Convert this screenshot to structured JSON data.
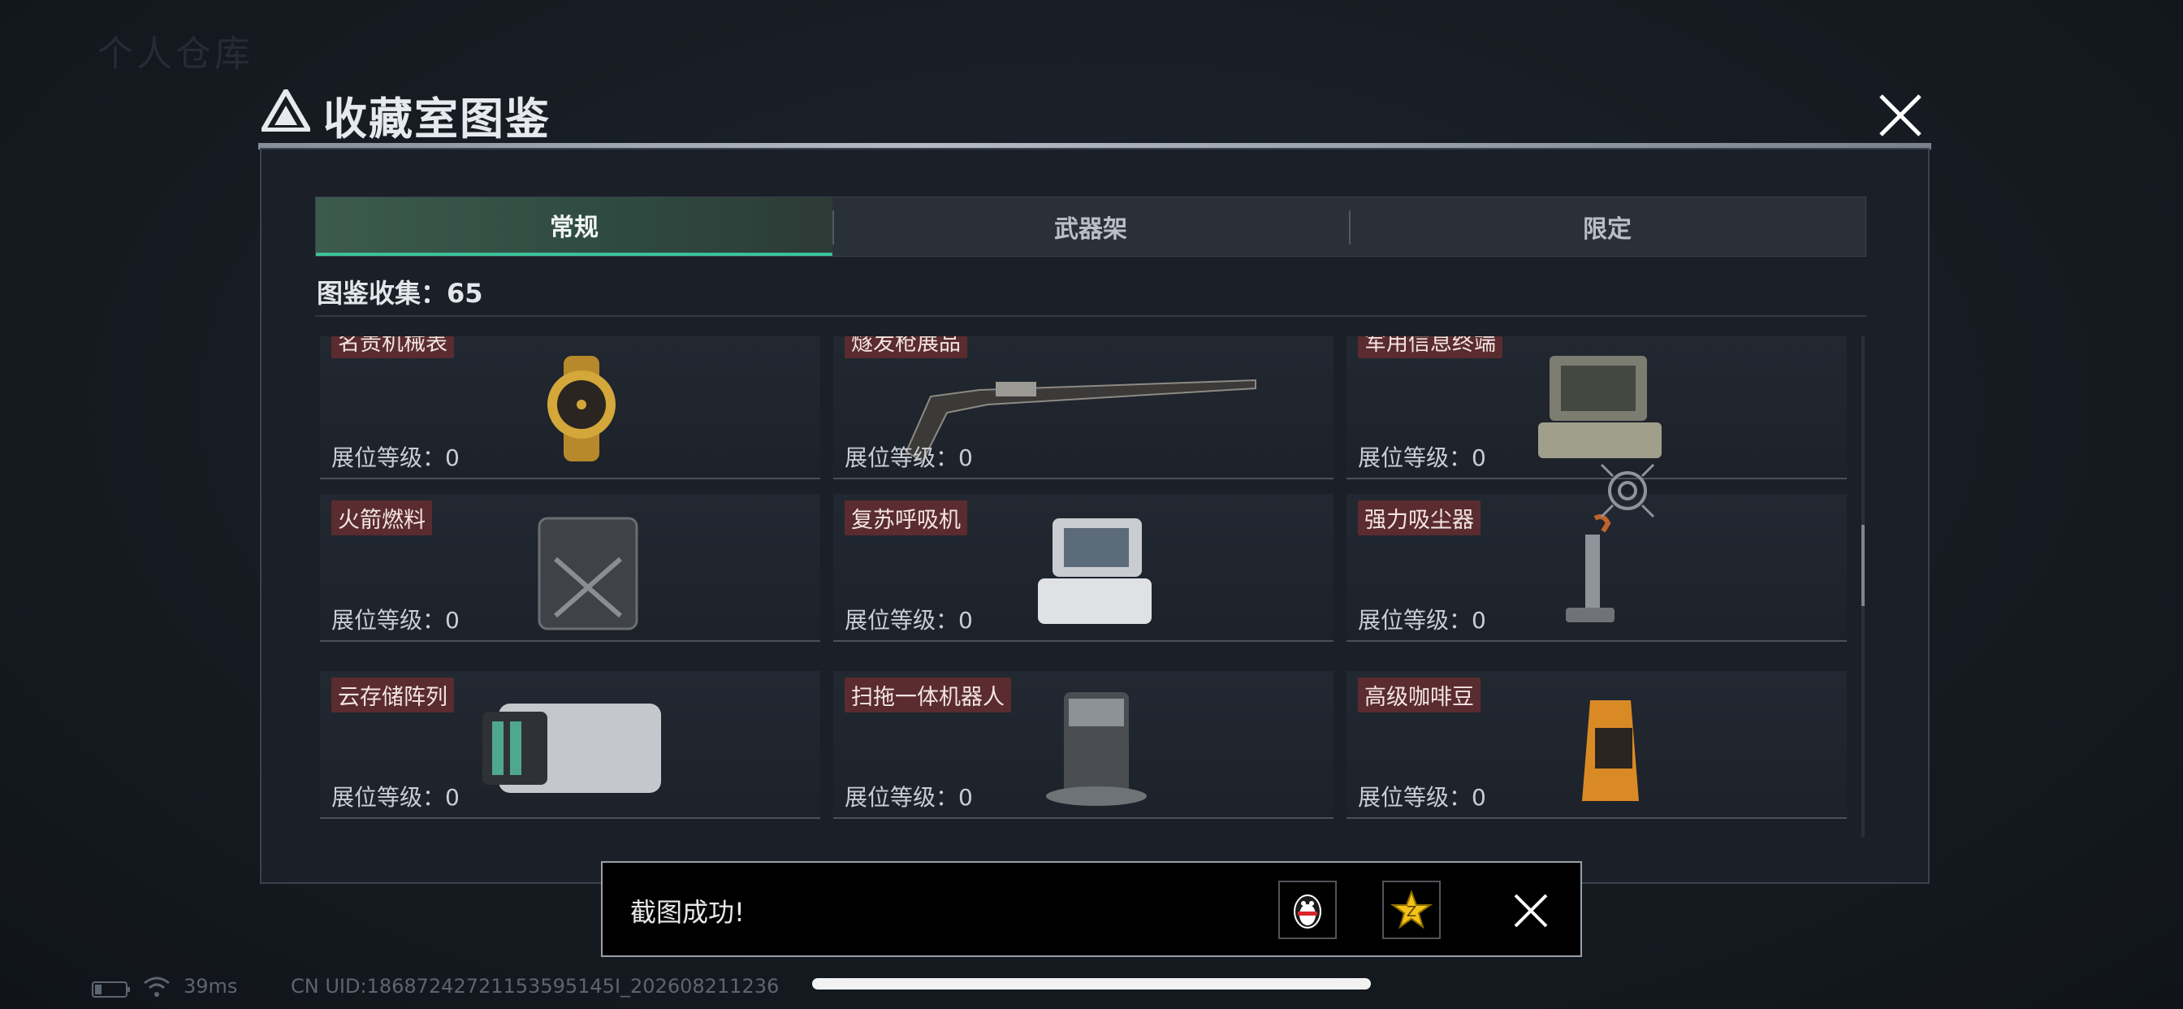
{
  "background": {
    "ghost_title": "个人仓库"
  },
  "modal": {
    "title": "收藏室图鉴",
    "tabs": [
      {
        "label": "常规",
        "active": true
      },
      {
        "label": "武器架",
        "active": false
      },
      {
        "label": "限定",
        "active": false
      }
    ],
    "collection_label": "图鉴收集：65",
    "items": [
      {
        "name": "名贵机械表",
        "level": "展位等级：0",
        "icon": "gold-watch"
      },
      {
        "name": "燧发枪展品",
        "level": "展位等级：0",
        "icon": "flintlock-rifle"
      },
      {
        "name": "军用信息终端",
        "level": "展位等级：0",
        "icon": "rugged-terminal-case"
      },
      {
        "name": "火箭燃料",
        "level": "展位等级：0",
        "icon": "fuel-canister"
      },
      {
        "name": "复苏呼吸机",
        "level": "展位等级：0",
        "icon": "ventilator"
      },
      {
        "name": "强力吸尘器",
        "level": "展位等级：0",
        "icon": "vacuum-cleaner"
      },
      {
        "name": "云存储阵列",
        "level": "展位等级：0",
        "icon": "storage-array"
      },
      {
        "name": "扫拖一体机器人",
        "level": "展位等级：0",
        "icon": "robot-vacuum-station"
      },
      {
        "name": "高级咖啡豆",
        "level": "展位等级：0",
        "icon": "coffee-bag"
      }
    ]
  },
  "toast": {
    "message": "截图成功!"
  },
  "status_bar": {
    "ping": "39ms",
    "uid": "CN UID:18687242721153595145I_202608211236"
  },
  "colors": {
    "accent": "#3bc29a",
    "tag": "#5a2c2f"
  }
}
